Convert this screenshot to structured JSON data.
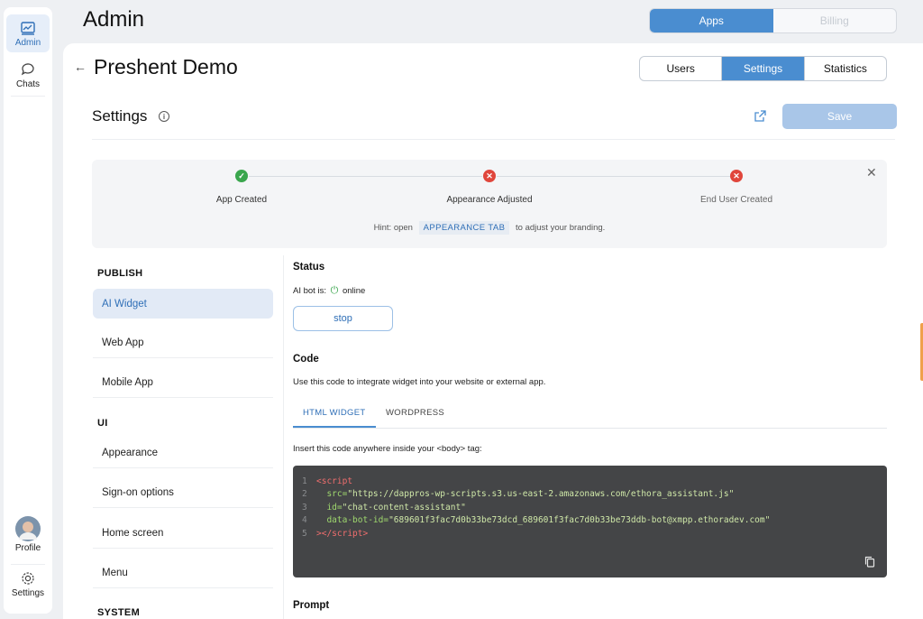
{
  "rail": {
    "admin": "Admin",
    "chats": "Chats",
    "profile": "Profile",
    "settings": "Settings"
  },
  "app_title": "Admin",
  "top_tabs": [
    "Apps",
    "Billing"
  ],
  "page": {
    "back": "←",
    "title": "Preshent Demo",
    "tabs": [
      "Users",
      "Settings",
      "Statistics"
    ]
  },
  "settings": {
    "heading": "Settings",
    "info": "i",
    "save": "Save"
  },
  "progress": {
    "steps": [
      {
        "label": "App Created",
        "status": "done"
      },
      {
        "label": "Appearance Adjusted",
        "status": "error"
      },
      {
        "label": "End User Created",
        "status": "error"
      }
    ],
    "hint_before": "Hint: open",
    "hint_tab": "APPEARANCE TAB",
    "hint_after": "to adjust your branding.",
    "close": "✕"
  },
  "nav": {
    "publish": "PUBLISH",
    "ui": "UI",
    "system": "SYSTEM",
    "publish_items": [
      "AI Widget",
      "Web App",
      "Mobile App"
    ],
    "ui_items": [
      "Appearance",
      "Sign-on options",
      "Home screen",
      "Menu"
    ]
  },
  "status": {
    "heading": "Status",
    "bot_label": "AI bot is:",
    "state": "online",
    "stop": "stop"
  },
  "code": {
    "heading": "Code",
    "description": "Use this code to integrate widget into your website or external app.",
    "tabs": [
      "HTML WIDGET",
      "WORDPRESS"
    ],
    "instruction": "Insert this code anywhere inside your <body> tag:",
    "lines": [
      {
        "n": "1",
        "open": "<",
        "tag": "script",
        "rest": ""
      },
      {
        "n": "2",
        "attr": "  src=",
        "value": "\"https://dappros-wp-scripts.s3.us-east-2.amazonaws.com/ethora_assistant.js\""
      },
      {
        "n": "3",
        "attr": "  id=",
        "value": "\"chat-content-assistant\""
      },
      {
        "n": "4",
        "attr": "  data-bot-id=",
        "value": "\"689601f3fac7d0b33be73dcd_689601f3fac7d0b33be73ddb-bot@xmpp.ethoradev.com\""
      },
      {
        "n": "5",
        "open": "></",
        "tag": "script",
        "rest": ">"
      }
    ]
  },
  "prompt": {
    "heading": "Prompt"
  },
  "colors": {
    "accent": "#4a8dd0",
    "success": "#3aa64d",
    "error": "#e0463c"
  }
}
